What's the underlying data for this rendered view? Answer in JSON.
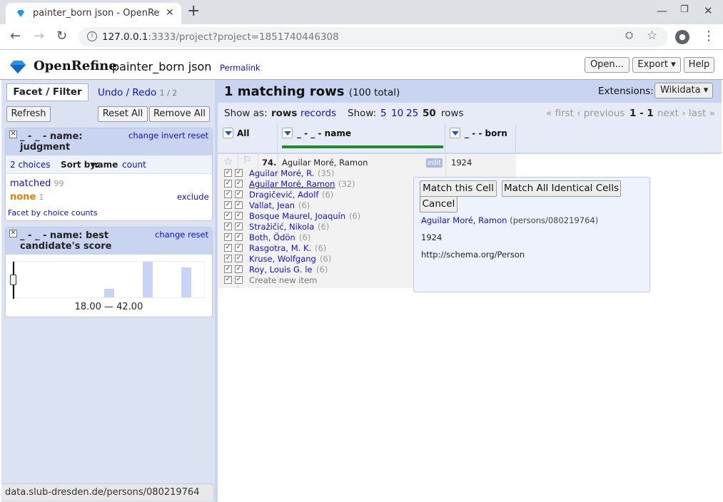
{
  "browser": {
    "tab_title": "painter_born json - OpenRefine",
    "url_host": "127.0.0.1",
    "url_rest": ":3333/project?project=1851740446308",
    "account_icon": "person-icon"
  },
  "header": {
    "brand": "OpenRefine",
    "project_name": "painter_born json",
    "permalink": "Permalink",
    "open_label": "Open...",
    "export_label": "Export",
    "help_label": "Help"
  },
  "left": {
    "tab_facet": "Facet / Filter",
    "tab_undo": "Undo / Redo",
    "undo_count": "1 / 2",
    "refresh": "Refresh",
    "reset_all": "Reset All",
    "remove_all": "Remove All",
    "facet1": {
      "title_line1": "_ - _ - name:",
      "title_line2": "judgment",
      "change": "change",
      "invert": "invert",
      "reset": "reset",
      "choices": "2 choices",
      "sort_by": "Sort by:",
      "sort_name": "name",
      "sort_count": "count",
      "items": [
        {
          "label": "matched",
          "count": "99"
        },
        {
          "label": "none",
          "count": "1",
          "action": "exclude"
        }
      ],
      "facet_by_counts": "Facet by choice counts"
    },
    "facet2": {
      "title_line1": "_ - _ - name: best",
      "title_line2": "candidate's score",
      "change": "change",
      "reset": "reset",
      "range": "18.00 — 42.00"
    }
  },
  "right": {
    "matching": "1 matching rows",
    "total": "(100 total)",
    "extensions_label": "Extensions:",
    "extensions_value": "Wikidata",
    "show_as": "Show as:",
    "mode_rows": "rows",
    "mode_records": "records",
    "show": "Show:",
    "page_sizes": [
      "5",
      "10",
      "25",
      "50"
    ],
    "rows_word": "rows",
    "pager_first": "« first",
    "pager_prev": "‹ previous",
    "pager_range": "1 - 1",
    "pager_next": "next ›",
    "pager_last": "last »",
    "columns": [
      "All",
      "_ - _ - name",
      "_ - - born"
    ],
    "row": {
      "index": "74.",
      "name": "Aguilar Moré, Ramon",
      "edit": "edit",
      "born": "1924",
      "candidates": [
        {
          "name": "Aguilar Moré, R.",
          "score": "(35)"
        },
        {
          "name": "Aguilar Moré, Ramon",
          "score": "(32)"
        },
        {
          "name": "Dragičević, Adolf",
          "score": "(6)"
        },
        {
          "name": "Vallat, Jean",
          "score": "(6)"
        },
        {
          "name": "Bosque Maurel, Joaquín",
          "score": "(6)"
        },
        {
          "name": "Stražičić, Nikola",
          "score": "(6)"
        },
        {
          "name": "Both, Ödön",
          "score": "(6)"
        },
        {
          "name": "Rasgotra, M. K.",
          "score": "(6)"
        },
        {
          "name": "Kruse, Wolfgang",
          "score": "(6)"
        },
        {
          "name": "Roy, Louis G. le",
          "score": "(6)"
        }
      ],
      "create_new": "Create new item"
    }
  },
  "popup": {
    "match_cell": "Match this Cell",
    "match_all": "Match All Identical Cells",
    "cancel": "Cancel",
    "entity_name": "Aguilar Moré, Ramon",
    "entity_id": "(persons/080219764)",
    "born": "1924",
    "type": "http://schema.org/Person"
  },
  "status_url": "data.slub-dresden.de/persons/080219764",
  "histogram": [
    0,
    0,
    0,
    0,
    0,
    0,
    0,
    0.25,
    0,
    0,
    1.0,
    0,
    0,
    0.85,
    0
  ]
}
